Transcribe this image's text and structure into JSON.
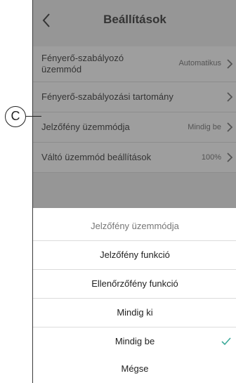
{
  "header": {
    "title": "Beállítások"
  },
  "settings_rows": [
    {
      "label": "Fényerő-szabályozó üzemmód",
      "value": "Automatikus"
    },
    {
      "label": "Fényerő-szabályozási tartomány",
      "value": ""
    },
    {
      "label": "Jelzőfény üzemmódja",
      "value": "Mindig be"
    },
    {
      "label": "Váltó üzemmód beállítások",
      "value": "100%"
    }
  ],
  "sheet": {
    "title": "Jelzőfény üzemmódja",
    "options": [
      "Jelzőfény funkció",
      "Ellenőrzőfény funkció",
      "Mindig ki",
      "Mindig be"
    ],
    "selected": "Mindig be",
    "cancel_label": "Mégse"
  },
  "callout": {
    "label": "C"
  },
  "colors": {
    "check": "#3daa9a",
    "overlay": "rgba(0,0,0,0.38)"
  },
  "icons": {
    "back": "chevron-left-icon",
    "row": "chevron-right-icon",
    "selected": "checkmark-icon"
  }
}
